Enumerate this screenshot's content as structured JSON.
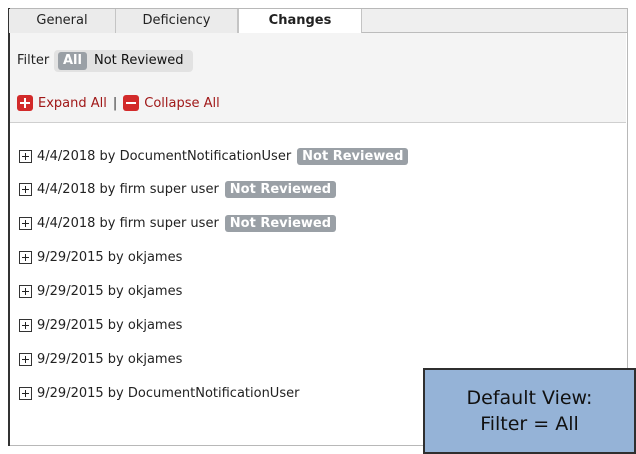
{
  "tabs": [
    {
      "label": "General"
    },
    {
      "label": "Deficiency"
    },
    {
      "label": "Changes"
    }
  ],
  "filter": {
    "label": "Filter",
    "options": [
      {
        "label": "All",
        "active": true
      },
      {
        "label": "Not Reviewed",
        "active": false
      }
    ]
  },
  "actions": {
    "expand_all": "Expand All",
    "separator": "|",
    "collapse_all": "Collapse All"
  },
  "changes": [
    {
      "text": "4/4/2018 by DocumentNotificationUser",
      "badge": "Not Reviewed"
    },
    {
      "text": "4/4/2018 by firm super user",
      "badge": "Not Reviewed"
    },
    {
      "text": "4/4/2018 by firm super user",
      "badge": "Not Reviewed"
    },
    {
      "text": "9/29/2015 by okjames",
      "badge": ""
    },
    {
      "text": "9/29/2015 by okjames",
      "badge": ""
    },
    {
      "text": "9/29/2015 by okjames",
      "badge": ""
    },
    {
      "text": "9/29/2015 by okjames",
      "badge": ""
    },
    {
      "text": "9/29/2015 by DocumentNotificationUser",
      "badge": ""
    }
  ],
  "callout": {
    "line1": "Default View:",
    "line2": "Filter = All"
  },
  "colors": {
    "badge": "#9aa0a6",
    "action_icon": "#d22a2a",
    "callout_bg": "#95b3d7"
  }
}
